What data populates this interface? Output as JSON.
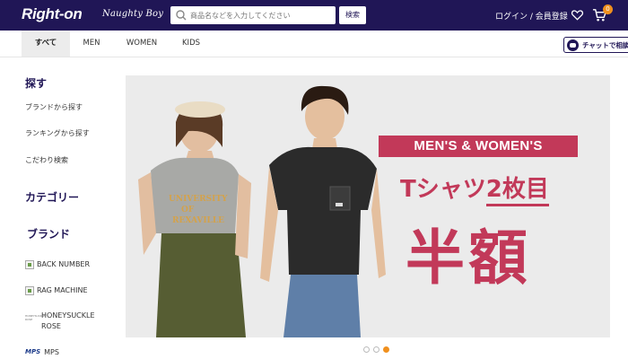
{
  "header": {
    "logo": "Right-on",
    "sublogo": "Naughty Boy",
    "search": {
      "placeholder": "商品名などを入力してください",
      "button_label": "検索"
    },
    "login_label": "ログイン / 会員登録",
    "cart_count": "0"
  },
  "nav": {
    "tabs": [
      {
        "label": "すべて",
        "active": true
      },
      {
        "label": "MEN"
      },
      {
        "label": "WOMEN"
      },
      {
        "label": "KIDS"
      }
    ],
    "chat_label": "チャットで相談"
  },
  "sidebar": {
    "search_heading": "探す",
    "search_links": [
      "ブランドから探す",
      "ランキングから探す",
      "こだわり検索"
    ],
    "category_heading": "カテゴリー",
    "brand_heading": "ブランド",
    "brands": [
      "BACK NUMBER",
      "RAG MACHINE",
      "HONEYSUCKLE ROSE",
      "MPS"
    ],
    "honeysuckle_logo_text": "HONEYSUCKLE ROSE",
    "mps_logo_text": "MPS"
  },
  "banner": {
    "ribbon": "MEN'S & WOMEN'S",
    "line2_part1": "Tシャツ",
    "line2_part2": "2枚目",
    "line3": "半額",
    "slides_total": 3,
    "active_slide": 3
  },
  "colors": {
    "header_bg": "#201656",
    "accent_pink": "#c23959",
    "badge_orange": "#f0901e"
  }
}
